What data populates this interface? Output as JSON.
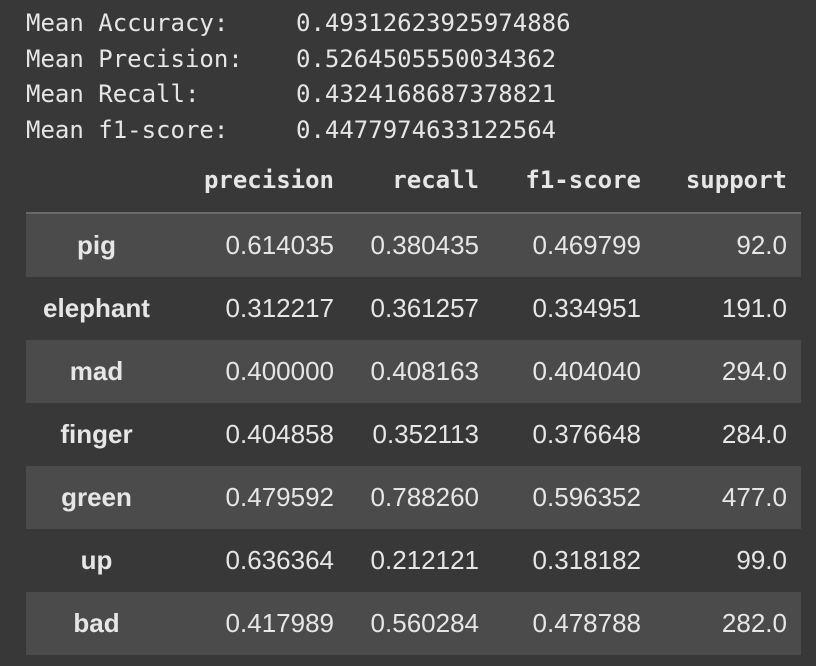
{
  "metrics": [
    {
      "label": "Mean Accuracy:",
      "value": "0.49312623925974886"
    },
    {
      "label": "Mean Precision:",
      "value": "0.5264505550034362"
    },
    {
      "label": "Mean Recall:",
      "value": "0.4324168687378821"
    },
    {
      "label": "Mean f1-score:",
      "value": "0.4477974633122564"
    }
  ],
  "table": {
    "headers": [
      "precision",
      "recall",
      "f1-score",
      "support"
    ],
    "rows": [
      {
        "label": "pig",
        "precision": "0.614035",
        "recall": "0.380435",
        "f1": "0.469799",
        "support": "92.0"
      },
      {
        "label": "elephant",
        "precision": "0.312217",
        "recall": "0.361257",
        "f1": "0.334951",
        "support": "191.0"
      },
      {
        "label": "mad",
        "precision": "0.400000",
        "recall": "0.408163",
        "f1": "0.404040",
        "support": "294.0"
      },
      {
        "label": "finger",
        "precision": "0.404858",
        "recall": "0.352113",
        "f1": "0.376648",
        "support": "284.0"
      },
      {
        "label": "green",
        "precision": "0.479592",
        "recall": "0.788260",
        "f1": "0.596352",
        "support": "477.0"
      },
      {
        "label": "up",
        "precision": "0.636364",
        "recall": "0.212121",
        "f1": "0.318182",
        "support": "99.0"
      },
      {
        "label": "bad",
        "precision": "0.417989",
        "recall": "0.560284",
        "f1": "0.478788",
        "support": "282.0"
      }
    ]
  },
  "colors": {
    "background": "#383838",
    "stripe": "#4b4b4b",
    "text": "#e6e6e6",
    "header_rule": "#6a6a6a"
  }
}
